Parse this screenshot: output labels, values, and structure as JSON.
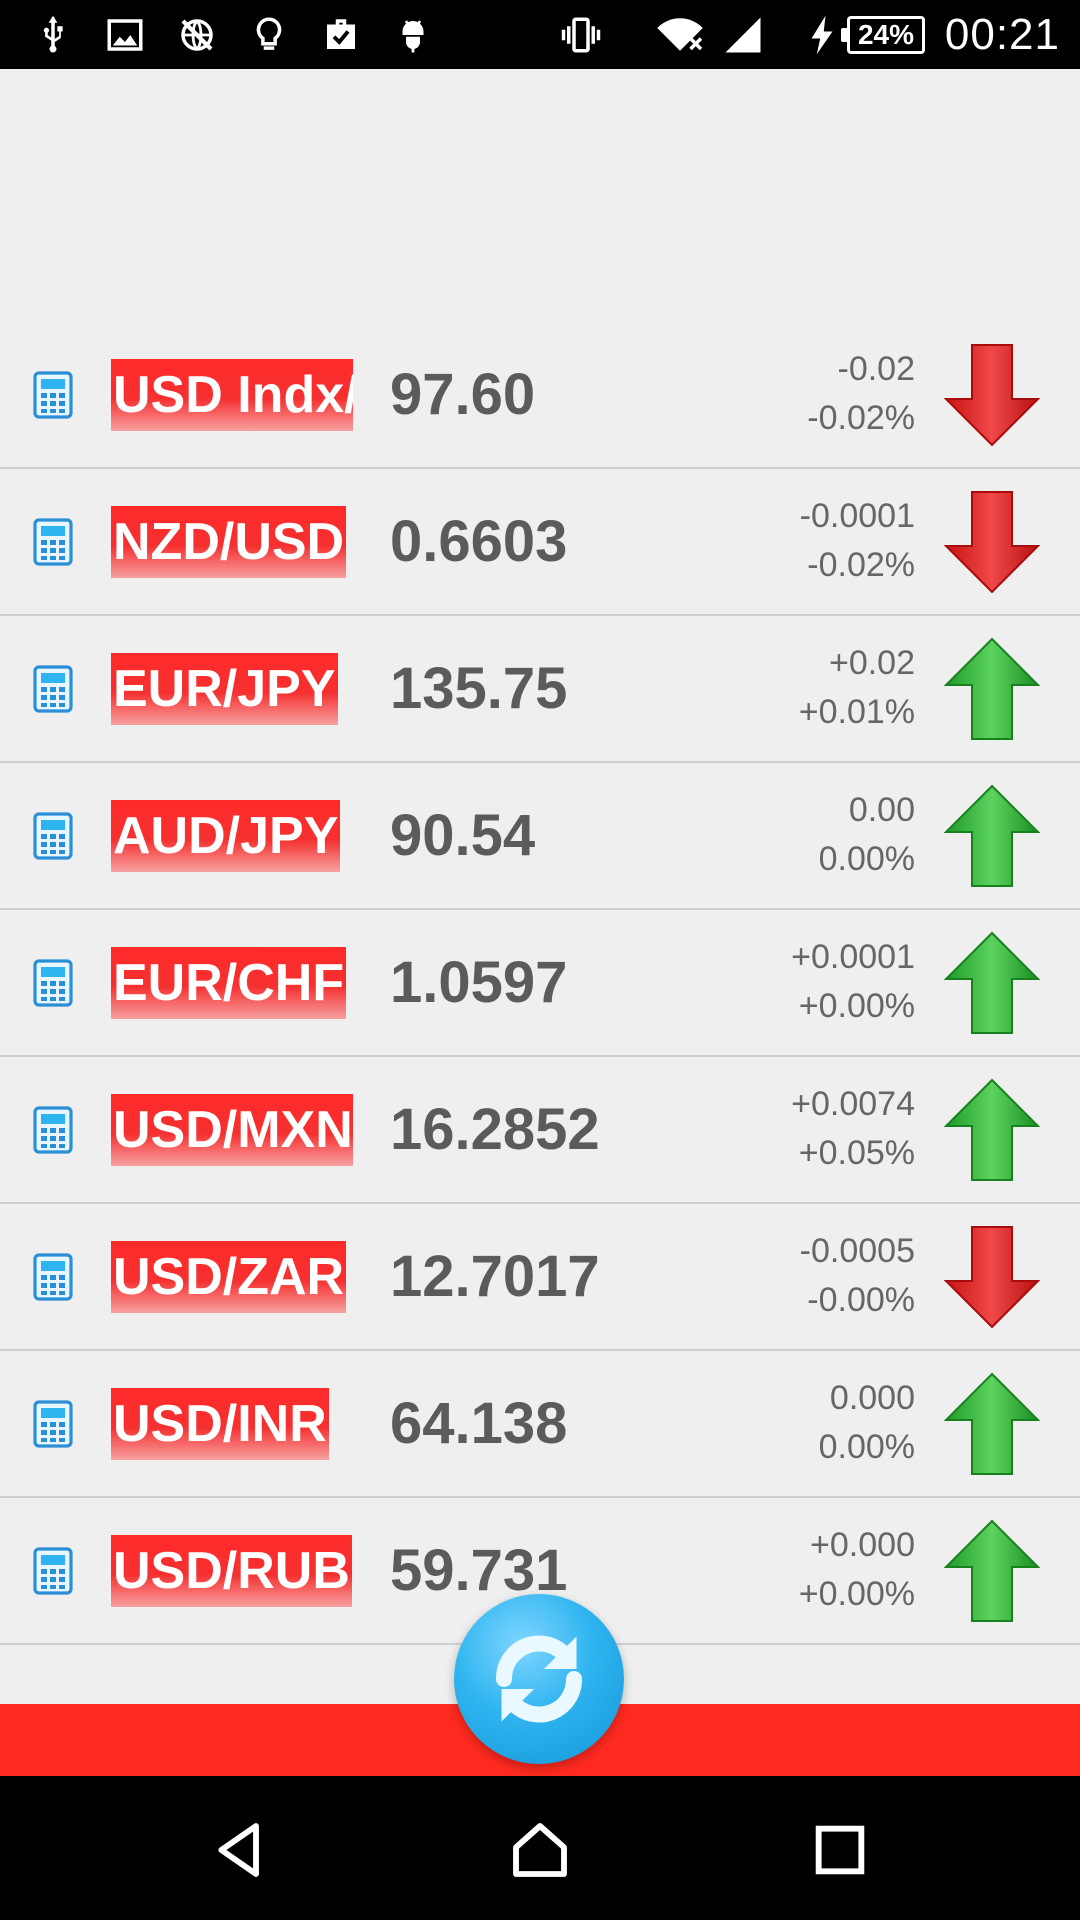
{
  "status_bar": {
    "battery": "24%",
    "time": "00:21",
    "icons": [
      "usb-icon",
      "image-icon",
      "no-sync-icon",
      "lightbulb-icon",
      "briefcase-check-icon",
      "android-icon",
      "vibrate-icon",
      "wifi-icon",
      "signal-icon",
      "charging-icon"
    ]
  },
  "rates": [
    {
      "pair": "USD Indx/",
      "price": "97.60",
      "change": "-0.02",
      "percent": "-0.02%",
      "direction": "down"
    },
    {
      "pair": "NZD/USD",
      "price": "0.6603",
      "change": "-0.0001",
      "percent": "-0.02%",
      "direction": "down"
    },
    {
      "pair": "EUR/JPY",
      "price": "135.75",
      "change": "+0.02",
      "percent": "+0.01%",
      "direction": "up"
    },
    {
      "pair": "AUD/JPY",
      "price": "90.54",
      "change": "0.00",
      "percent": "0.00%",
      "direction": "up"
    },
    {
      "pair": "EUR/CHF",
      "price": "1.0597",
      "change": "+0.0001",
      "percent": "+0.00%",
      "direction": "up"
    },
    {
      "pair": "USD/MXN",
      "price": "16.2852",
      "change": "+0.0074",
      "percent": "+0.05%",
      "direction": "up"
    },
    {
      "pair": "USD/ZAR",
      "price": "12.7017",
      "change": "-0.0005",
      "percent": "-0.00%",
      "direction": "down"
    },
    {
      "pair": "USD/INR",
      "price": "64.138",
      "change": "0.000",
      "percent": "0.00%",
      "direction": "up"
    },
    {
      "pair": "USD/RUB",
      "price": "59.731",
      "change": "+0.000",
      "percent": "+0.00%",
      "direction": "up"
    }
  ],
  "colors": {
    "badge_red": "#f53030",
    "bottom_bar": "#ff2a1f",
    "up_green": "#22b02a",
    "down_red": "#e01c1c",
    "fab_blue": "#2fb4f0"
  },
  "nav": [
    "back-icon",
    "home-icon",
    "recents-icon"
  ]
}
